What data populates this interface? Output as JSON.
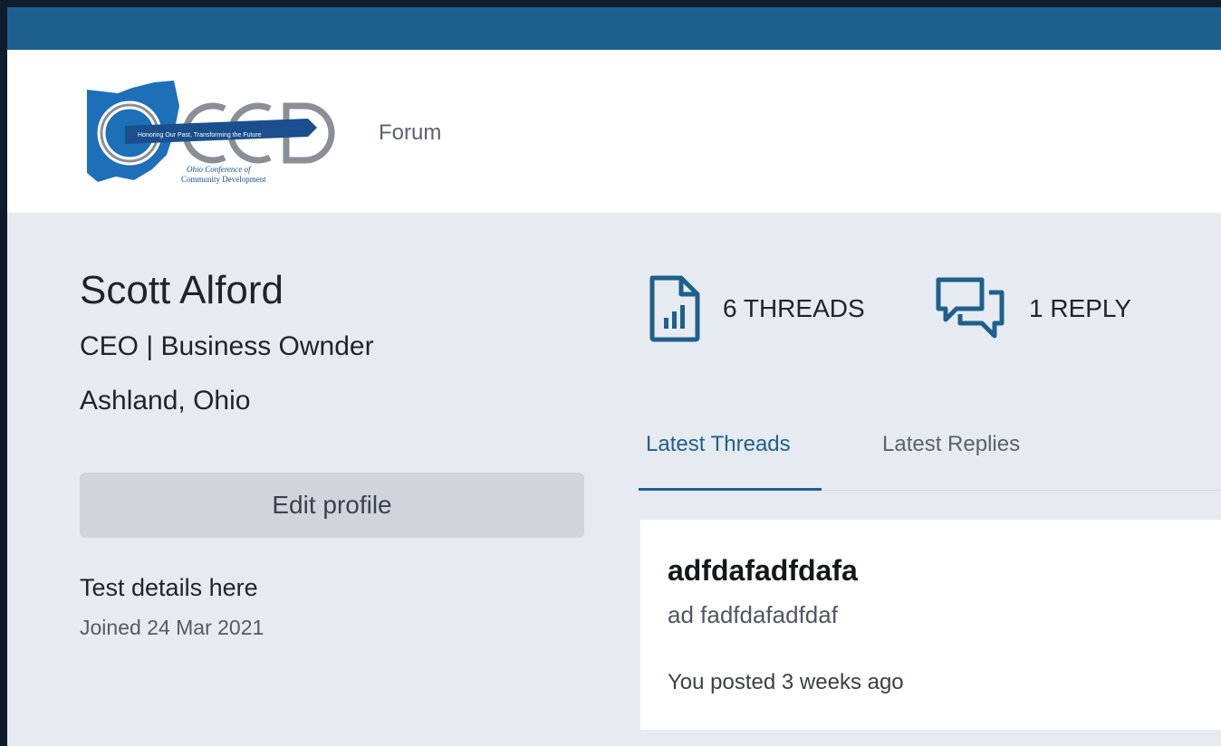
{
  "header": {
    "logo": {
      "letters": "OCCD",
      "banner_text": "Honoring Our Past, Transforming the Future",
      "subtitle_line1": "Ohio Conference of",
      "subtitle_line2": "Community Development"
    },
    "nav": {
      "forum": "Forum"
    }
  },
  "profile": {
    "name": "Scott Alford",
    "role": "CEO | Business Ownder",
    "location": "Ashland, Ohio",
    "edit_button": "Edit profile",
    "details": "Test details here",
    "joined": "Joined 24 Mar 2021"
  },
  "stats": {
    "threads": {
      "label": "6 THREADS",
      "icon": "document-chart-icon"
    },
    "replies": {
      "label": "1 REPLY",
      "icon": "chat-bubbles-icon"
    }
  },
  "tabs": [
    {
      "label": "Latest Threads",
      "active": true
    },
    {
      "label": "Latest Replies",
      "active": false
    }
  ],
  "threads": [
    {
      "title": "adfdafadfdafa",
      "body": "ad fadfdafadfdaf",
      "meta": "You posted 3 weeks ago"
    }
  ],
  "colors": {
    "topbar": "#1c5f8d",
    "accent": "#1f5f8c",
    "page_bg": "#e6ebf1",
    "button_bg": "#d0d4db"
  }
}
